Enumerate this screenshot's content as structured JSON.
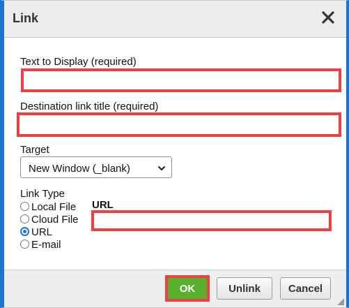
{
  "dialog": {
    "title": "Link",
    "close_icon": "close-icon"
  },
  "fields": {
    "text_to_display": {
      "label": "Text to Display (required)",
      "value": ""
    },
    "destination_title": {
      "label": "Destination link title (required)",
      "value": ""
    },
    "target": {
      "label": "Target",
      "selected": "New Window (_blank)"
    },
    "link_type": {
      "label": "Link Type",
      "options": [
        {
          "label": "Local File",
          "checked": false
        },
        {
          "label": "Cloud File",
          "checked": false
        },
        {
          "label": "URL",
          "checked": true
        },
        {
          "label": "E-mail",
          "checked": false
        }
      ]
    },
    "url": {
      "label": "URL",
      "value": ""
    }
  },
  "buttons": {
    "ok": "OK",
    "unlink": "Unlink",
    "cancel": "Cancel"
  },
  "colors": {
    "accent_border": "#1b75d0",
    "highlight_red": "#ef3f44",
    "ok_green": "#59b02c",
    "radio_blue": "#1a73e8"
  }
}
